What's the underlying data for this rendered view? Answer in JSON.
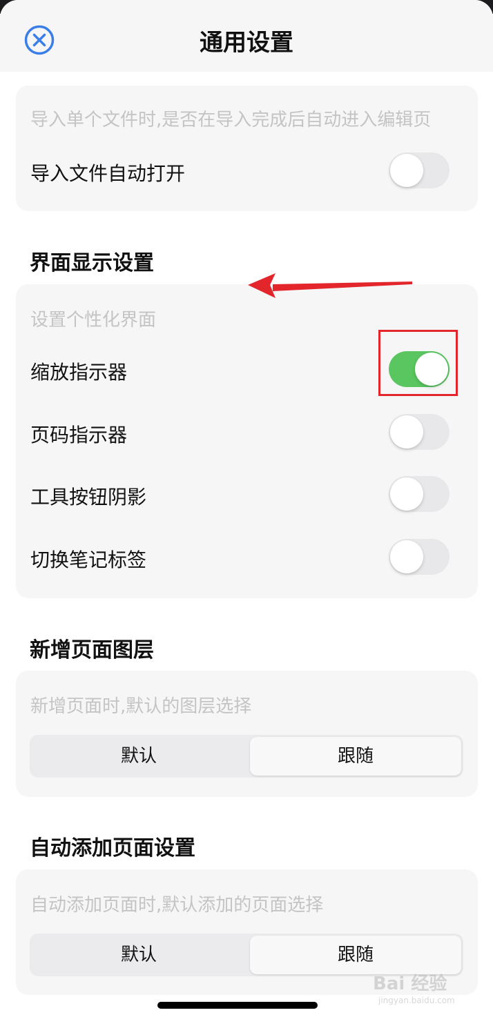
{
  "header": {
    "title": "通用设置",
    "close_icon": "close-circle-icon",
    "accent_color": "#3a7ee8"
  },
  "import_card": {
    "description": "导入单个文件时,是否在导入完成后自动进入编辑页",
    "rows": [
      {
        "label": "导入文件自动打开",
        "on": false
      }
    ]
  },
  "display_section": {
    "title": "界面显示设置",
    "description": "设置个性化界面",
    "rows": [
      {
        "label": "缩放指示器",
        "on": true
      },
      {
        "label": "页码指示器",
        "on": false
      },
      {
        "label": "工具按钮阴影",
        "on": false
      },
      {
        "label": "切换笔记标签",
        "on": false
      }
    ]
  },
  "new_page_layer_section": {
    "title": "新增页面图层",
    "description": "新增页面时,默认的图层选择",
    "options": [
      "默认",
      "跟随"
    ],
    "selected": "跟随"
  },
  "auto_add_page_section": {
    "title": "自动添加页面设置",
    "description": "自动添加页面时,默认添加的页面选择",
    "options": [
      "默认",
      "跟随"
    ],
    "selected": "跟随"
  },
  "colors": {
    "switch_on": "#5ac660",
    "switch_off": "#e8e8ea",
    "annotation_red": "#e3252c"
  },
  "watermark": {
    "text": "Bai  经验",
    "sub": "jingyan.baidu.com"
  }
}
